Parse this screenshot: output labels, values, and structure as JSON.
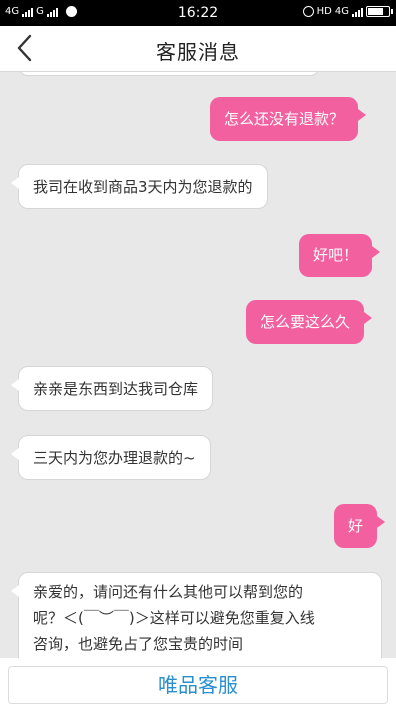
{
  "status_bar": {
    "left_net1": "4G",
    "left_net2": "G",
    "time": "16:22",
    "right_hd": "HD",
    "right_net": "4G",
    "battery_level": 0.8
  },
  "header": {
    "back_icon": "chevron-left-icon",
    "title": "客服消息"
  },
  "messages": [
    {
      "side": "out",
      "text": "怎么还没有退款？"
    },
    {
      "side": "in",
      "text": "我司在收到商品3天内为您退款的"
    },
    {
      "side": "out",
      "text": "好吧！"
    },
    {
      "side": "out",
      "text": "怎么要这么久"
    },
    {
      "side": "in",
      "text": "亲亲是东西到达我司仓库"
    },
    {
      "side": "in",
      "text": "三天内为您办理退款的~"
    },
    {
      "side": "out",
      "text": "好"
    },
    {
      "side": "in",
      "lines": [
        "亲爱的，请问还有什么其他可以帮到您的",
        "呢？＜(￣︶￣)＞这样可以避免您重复入线",
        "咨询，也避免占了您宝贵的时间"
      ]
    }
  ],
  "bottom": {
    "button_label": "唯品客服"
  },
  "colors": {
    "outgoing_bubble": "#f2609f",
    "incoming_bubble": "#ffffff",
    "accent_text": "#2a8fd0"
  }
}
